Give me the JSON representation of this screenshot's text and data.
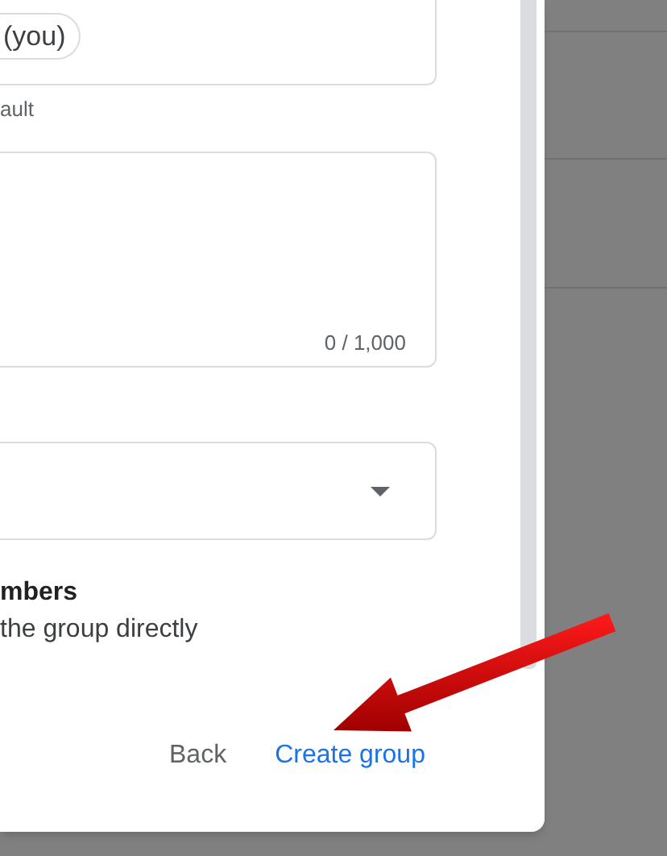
{
  "owner_chip": "(you)",
  "hint": "ault",
  "description_counter": "0 / 1,000",
  "setting": {
    "title": "mbers",
    "description": "the group directly"
  },
  "buttons": [
    {
      "label": "Back",
      "kind": "text"
    },
    {
      "label": "Create group",
      "kind": "primary"
    }
  ]
}
